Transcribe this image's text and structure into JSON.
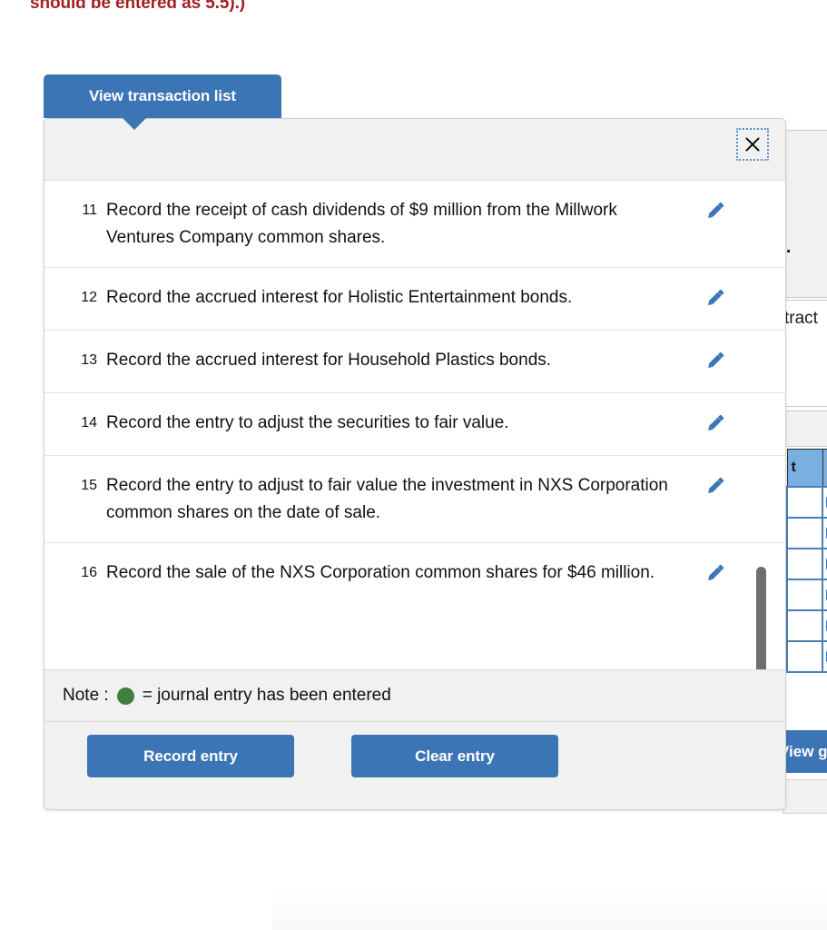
{
  "page": {
    "instruction_fragment": "should be entered as 5.5).)",
    "instruction_color": "#a41f23"
  },
  "tab": {
    "label": "View transaction list",
    "color": "#3b75b5"
  },
  "dialog": {
    "close_icon": "close-x-icon",
    "accent_color": "#3b75b5",
    "header_background": "#f1f1f1"
  },
  "transactions": [
    {
      "number": "11",
      "text": "Record the receipt of cash dividends of $9 million from the Millwork Ventures Company common shares.",
      "edit_icon": "pencil-icon"
    },
    {
      "number": "12",
      "text": "Record the accrued interest for Holistic Entertainment bonds.",
      "edit_icon": "pencil-icon"
    },
    {
      "number": "13",
      "text": "Record the accrued interest for Household Plastics bonds.",
      "edit_icon": "pencil-icon"
    },
    {
      "number": "14",
      "text": "Record the entry to adjust the securities to fair value.",
      "edit_icon": "pencil-icon"
    },
    {
      "number": "15",
      "text": "Record the entry to adjust to fair value the investment in NXS Corporation common shares on the date of sale.",
      "edit_icon": "pencil-icon"
    },
    {
      "number": "16",
      "text": "Record the sale of the NXS Corporation common shares for $46 million.",
      "edit_icon": "pencil-icon"
    }
  ],
  "note": {
    "prefix": "Note : ",
    "dot_color": "#3f8040",
    "suffix": "= journal entry has been entered"
  },
  "footer": {
    "record_entry_label": "Record entry",
    "clear_entry_label": "Clear entry"
  },
  "background": {
    "view_journal_label": "View g",
    "period_mark": ".",
    "fragment_text": "tract",
    "table_header": "t",
    "table_row_count": 6,
    "table_header_color": "#7ab0e0",
    "table_border_color": "#4a7fb5"
  }
}
